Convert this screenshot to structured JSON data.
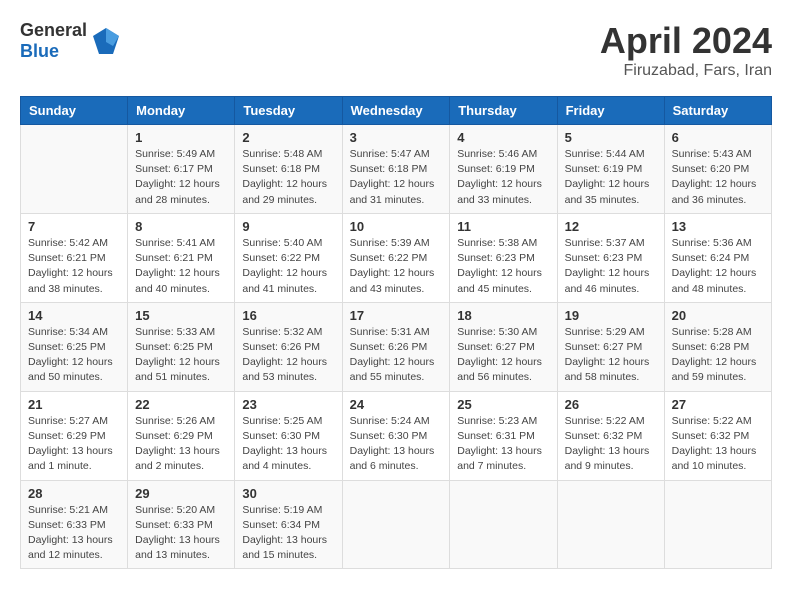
{
  "header": {
    "logo_general": "General",
    "logo_blue": "Blue",
    "month": "April 2024",
    "location": "Firuzabad, Fars, Iran"
  },
  "days_of_week": [
    "Sunday",
    "Monday",
    "Tuesday",
    "Wednesday",
    "Thursday",
    "Friday",
    "Saturday"
  ],
  "weeks": [
    [
      {
        "num": "",
        "sunrise": "",
        "sunset": "",
        "daylight": ""
      },
      {
        "num": "1",
        "sunrise": "Sunrise: 5:49 AM",
        "sunset": "Sunset: 6:17 PM",
        "daylight": "Daylight: 12 hours and 28 minutes."
      },
      {
        "num": "2",
        "sunrise": "Sunrise: 5:48 AM",
        "sunset": "Sunset: 6:18 PM",
        "daylight": "Daylight: 12 hours and 29 minutes."
      },
      {
        "num": "3",
        "sunrise": "Sunrise: 5:47 AM",
        "sunset": "Sunset: 6:18 PM",
        "daylight": "Daylight: 12 hours and 31 minutes."
      },
      {
        "num": "4",
        "sunrise": "Sunrise: 5:46 AM",
        "sunset": "Sunset: 6:19 PM",
        "daylight": "Daylight: 12 hours and 33 minutes."
      },
      {
        "num": "5",
        "sunrise": "Sunrise: 5:44 AM",
        "sunset": "Sunset: 6:19 PM",
        "daylight": "Daylight: 12 hours and 35 minutes."
      },
      {
        "num": "6",
        "sunrise": "Sunrise: 5:43 AM",
        "sunset": "Sunset: 6:20 PM",
        "daylight": "Daylight: 12 hours and 36 minutes."
      }
    ],
    [
      {
        "num": "7",
        "sunrise": "Sunrise: 5:42 AM",
        "sunset": "Sunset: 6:21 PM",
        "daylight": "Daylight: 12 hours and 38 minutes."
      },
      {
        "num": "8",
        "sunrise": "Sunrise: 5:41 AM",
        "sunset": "Sunset: 6:21 PM",
        "daylight": "Daylight: 12 hours and 40 minutes."
      },
      {
        "num": "9",
        "sunrise": "Sunrise: 5:40 AM",
        "sunset": "Sunset: 6:22 PM",
        "daylight": "Daylight: 12 hours and 41 minutes."
      },
      {
        "num": "10",
        "sunrise": "Sunrise: 5:39 AM",
        "sunset": "Sunset: 6:22 PM",
        "daylight": "Daylight: 12 hours and 43 minutes."
      },
      {
        "num": "11",
        "sunrise": "Sunrise: 5:38 AM",
        "sunset": "Sunset: 6:23 PM",
        "daylight": "Daylight: 12 hours and 45 minutes."
      },
      {
        "num": "12",
        "sunrise": "Sunrise: 5:37 AM",
        "sunset": "Sunset: 6:23 PM",
        "daylight": "Daylight: 12 hours and 46 minutes."
      },
      {
        "num": "13",
        "sunrise": "Sunrise: 5:36 AM",
        "sunset": "Sunset: 6:24 PM",
        "daylight": "Daylight: 12 hours and 48 minutes."
      }
    ],
    [
      {
        "num": "14",
        "sunrise": "Sunrise: 5:34 AM",
        "sunset": "Sunset: 6:25 PM",
        "daylight": "Daylight: 12 hours and 50 minutes."
      },
      {
        "num": "15",
        "sunrise": "Sunrise: 5:33 AM",
        "sunset": "Sunset: 6:25 PM",
        "daylight": "Daylight: 12 hours and 51 minutes."
      },
      {
        "num": "16",
        "sunrise": "Sunrise: 5:32 AM",
        "sunset": "Sunset: 6:26 PM",
        "daylight": "Daylight: 12 hours and 53 minutes."
      },
      {
        "num": "17",
        "sunrise": "Sunrise: 5:31 AM",
        "sunset": "Sunset: 6:26 PM",
        "daylight": "Daylight: 12 hours and 55 minutes."
      },
      {
        "num": "18",
        "sunrise": "Sunrise: 5:30 AM",
        "sunset": "Sunset: 6:27 PM",
        "daylight": "Daylight: 12 hours and 56 minutes."
      },
      {
        "num": "19",
        "sunrise": "Sunrise: 5:29 AM",
        "sunset": "Sunset: 6:27 PM",
        "daylight": "Daylight: 12 hours and 58 minutes."
      },
      {
        "num": "20",
        "sunrise": "Sunrise: 5:28 AM",
        "sunset": "Sunset: 6:28 PM",
        "daylight": "Daylight: 12 hours and 59 minutes."
      }
    ],
    [
      {
        "num": "21",
        "sunrise": "Sunrise: 5:27 AM",
        "sunset": "Sunset: 6:29 PM",
        "daylight": "Daylight: 13 hours and 1 minute."
      },
      {
        "num": "22",
        "sunrise": "Sunrise: 5:26 AM",
        "sunset": "Sunset: 6:29 PM",
        "daylight": "Daylight: 13 hours and 2 minutes."
      },
      {
        "num": "23",
        "sunrise": "Sunrise: 5:25 AM",
        "sunset": "Sunset: 6:30 PM",
        "daylight": "Daylight: 13 hours and 4 minutes."
      },
      {
        "num": "24",
        "sunrise": "Sunrise: 5:24 AM",
        "sunset": "Sunset: 6:30 PM",
        "daylight": "Daylight: 13 hours and 6 minutes."
      },
      {
        "num": "25",
        "sunrise": "Sunrise: 5:23 AM",
        "sunset": "Sunset: 6:31 PM",
        "daylight": "Daylight: 13 hours and 7 minutes."
      },
      {
        "num": "26",
        "sunrise": "Sunrise: 5:22 AM",
        "sunset": "Sunset: 6:32 PM",
        "daylight": "Daylight: 13 hours and 9 minutes."
      },
      {
        "num": "27",
        "sunrise": "Sunrise: 5:22 AM",
        "sunset": "Sunset: 6:32 PM",
        "daylight": "Daylight: 13 hours and 10 minutes."
      }
    ],
    [
      {
        "num": "28",
        "sunrise": "Sunrise: 5:21 AM",
        "sunset": "Sunset: 6:33 PM",
        "daylight": "Daylight: 13 hours and 12 minutes."
      },
      {
        "num": "29",
        "sunrise": "Sunrise: 5:20 AM",
        "sunset": "Sunset: 6:33 PM",
        "daylight": "Daylight: 13 hours and 13 minutes."
      },
      {
        "num": "30",
        "sunrise": "Sunrise: 5:19 AM",
        "sunset": "Sunset: 6:34 PM",
        "daylight": "Daylight: 13 hours and 15 minutes."
      },
      {
        "num": "",
        "sunrise": "",
        "sunset": "",
        "daylight": ""
      },
      {
        "num": "",
        "sunrise": "",
        "sunset": "",
        "daylight": ""
      },
      {
        "num": "",
        "sunrise": "",
        "sunset": "",
        "daylight": ""
      },
      {
        "num": "",
        "sunrise": "",
        "sunset": "",
        "daylight": ""
      }
    ]
  ]
}
